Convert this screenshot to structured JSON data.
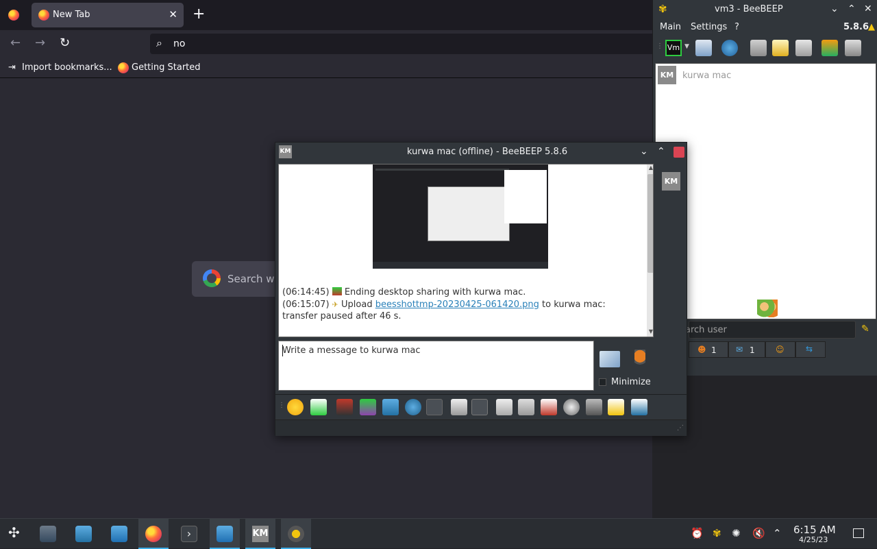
{
  "firefox": {
    "tab_title": "New Tab",
    "tab_close": "✕",
    "new_tab": "+",
    "url_value": "no",
    "bookmarks": [
      "Import bookmarks...",
      "Getting Started"
    ],
    "google_placeholder": "Search wi",
    "nav": {
      "back": "←",
      "forward": "→",
      "reload": "↻"
    }
  },
  "beebeep_main": {
    "title": "vm3 - BeeBEEP",
    "version": "5.8.6",
    "menu": [
      "Main",
      "Settings",
      "?"
    ],
    "user_initials": "KM",
    "user_name": "kurwa mac",
    "search_placeholder": "arch user",
    "bottom_tabs": [
      {
        "icon": "users-icon",
        "count": "1"
      },
      {
        "icon": "chat-icon",
        "count": "1"
      },
      {
        "icon": "group-icon",
        "count": ""
      },
      {
        "icon": "share-icon",
        "count": ""
      }
    ],
    "toolbar_badge": "Vm"
  },
  "chat": {
    "title": "kurwa mac (offline) - BeeBEEP 5.8.6",
    "avatar": "KM",
    "side_avatar": "KM",
    "messages": [
      {
        "time": "(06:14:45)",
        "text": "Ending desktop sharing with kurwa mac."
      },
      {
        "time": "(06:15:07)",
        "prefix": "Upload",
        "link": "beesshottmp-20230425-061420.png",
        "suffix": "to kurwa mac: transfer paused after 46 s."
      }
    ],
    "input_placeholder": "Write a message to kurwa mac",
    "minimize_label": "Minimize"
  },
  "taskbar": {
    "time": "6:15 AM",
    "date": "4/25/23",
    "km_label": "KM"
  },
  "colors": {
    "accent": "#3daee9",
    "close_red": "#da4453",
    "link": "#2980b9"
  }
}
